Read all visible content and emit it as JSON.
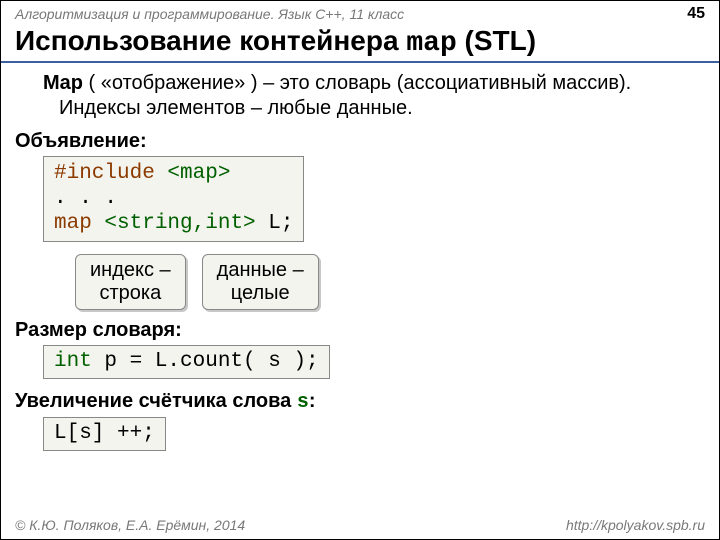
{
  "header": {
    "course": "Алгоритмизация и программирование. Язык C++, 11 класс",
    "page": "45"
  },
  "title": {
    "prefix": "Использование контейнера ",
    "mono": "map",
    "suffix": " (STL)"
  },
  "intro": {
    "bold": "Map",
    "rest": " ( «отображение» ) – это словарь (ассоциативный массив). Индексы элементов – любые данные."
  },
  "section1": {
    "label": "Объявление:",
    "code": {
      "line1a": "#include ",
      "line1b": "<map>",
      "line2": ". . .",
      "line3a": "map ",
      "line3b": "<string,int>",
      "line3c": " L;"
    }
  },
  "callouts": {
    "left": "индекс –\nстрока",
    "right": "данные –\nцелые"
  },
  "section2": {
    "label": "Размер словаря:",
    "code_a": "int",
    "code_b": " p = L.count( s );"
  },
  "section3": {
    "label_a": "Увеличение счётчика слова ",
    "label_s": "s",
    "label_b": ":",
    "code": "L[s] ++;"
  },
  "footer": {
    "left": "© К.Ю. Поляков, Е.А. Ерёмин, 2014",
    "right": "http://kpolyakov.spb.ru"
  }
}
